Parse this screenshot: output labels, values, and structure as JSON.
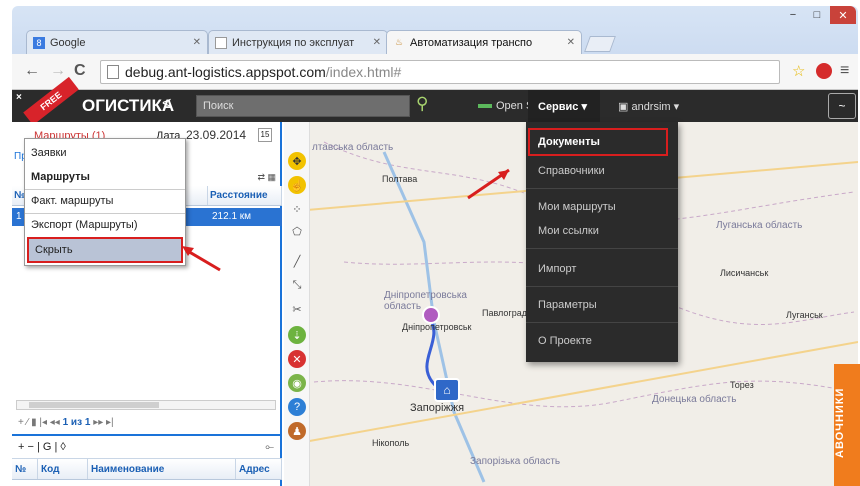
{
  "browser": {
    "tabs": [
      {
        "label": "Google",
        "icon": "google-icon"
      },
      {
        "label": "Инструкция по эксплуат",
        "icon": "doc-icon"
      },
      {
        "label": "Автоматизация транспо",
        "icon": "truck-icon"
      }
    ],
    "url_host": "debug.ant-logistics.appspot.com",
    "url_path": "/index.html#",
    "window_controls": [
      "−",
      "□",
      "✕"
    ]
  },
  "appbar": {
    "ribbon": "FREE",
    "logo": "ОГИСТИКА",
    "search_placeholder": "Поиск",
    "map_layer": "Open Street Map ▾",
    "service_menu": "Сервис ▾",
    "user": "andrsim ▾",
    "right_button": "~"
  },
  "left_panel": {
    "header_link": "Маршруты (1)",
    "date_label": "Дата",
    "date": "23.09.2014",
    "sub_link": "Пр",
    "grid_columns": [
      "№",
      "",
      "Расстояние"
    ],
    "rows": [
      {
        "num": "1",
        "name": "",
        "distance": "212.1 км"
      }
    ],
    "pager": {
      "first": "|◂",
      "prev": "◂◂",
      "page": "1 из 1",
      "next": "▸▸",
      "last": "▸|"
    },
    "bottom_toolbar": "+ − | G | ◊",
    "bottom_columns": [
      "№",
      "Код",
      "Наименование",
      "Адрес"
    ]
  },
  "context_menu": {
    "items": [
      "Заявки",
      "Маршруты",
      "Факт. маршруты",
      "Экспорт (Маршруты)"
    ],
    "hide": "Скрыть"
  },
  "service_dropdown": {
    "items": [
      "Документы",
      "Справочники",
      "Мои маршруты",
      "Мои ссылки",
      "Импорт",
      "Параметры",
      "О Проекте"
    ]
  },
  "map": {
    "labels": {
      "oblast1": "лтавська область",
      "poltava": "Полтава",
      "dnipro_obl": "Дніпропетровська область",
      "dnipro": "Дніпропетровськ",
      "pavlohrad": "Павлоград",
      "zaporizhzhia": "Запоріжжя",
      "zap_obl": "Запорізька область",
      "nikopol": "Нікополь",
      "donetsk_obl": "Донецька область",
      "luhansk_obl": "Луганська область",
      "lysychansk": "Лисичанськ",
      "luhansk": "Луганськ",
      "torez": "Торез"
    }
  },
  "side_tab": "АВОЧНИКИ",
  "colors": {
    "accent": "#1a73d9",
    "highlight": "#d81e1e",
    "sidetab": "#f07c1d"
  }
}
